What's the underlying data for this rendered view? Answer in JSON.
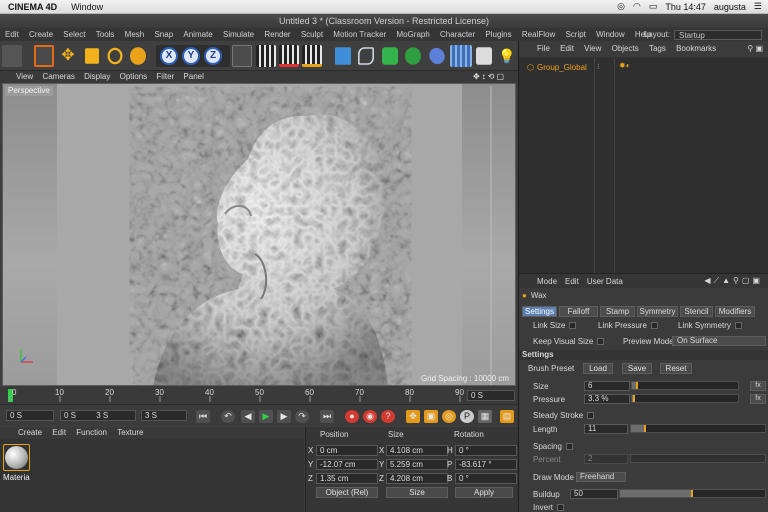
{
  "macbar": {
    "app": "CINEMA 4D",
    "menu": "Window",
    "clock": "Thu 14:47",
    "user": "augusta"
  },
  "window": {
    "title": "Untitled 3 * (Classroom Version - Restricted License)"
  },
  "menubar": {
    "items": [
      "Edit",
      "Create",
      "Select",
      "Tools",
      "Mesh",
      "Snap",
      "Animate",
      "Simulate",
      "Render",
      "Sculpt",
      "Motion Tracker",
      "MoGraph",
      "Character",
      "Plugins",
      "RealFlow",
      "Script",
      "Window",
      "Help"
    ],
    "layout_label": "Layout:",
    "layout_value": "Startup"
  },
  "viewport": {
    "menu": [
      "View",
      "Cameras",
      "Display",
      "Options",
      "Filter",
      "Panel"
    ],
    "label": "Perspective",
    "grid_spacing": "Grid Spacing : 10000 cm"
  },
  "timeline": {
    "ticks": [
      "0",
      "10",
      "20",
      "30",
      "40",
      "50",
      "60",
      "70",
      "80",
      "90"
    ],
    "end_frame": "0 S"
  },
  "transport": {
    "current": "0 S",
    "range_start": "0 S",
    "range_end": "3 S",
    "max": "3 S"
  },
  "material": {
    "menu": [
      "Create",
      "Edit",
      "Function",
      "Texture"
    ],
    "items": [
      {
        "name": "Materia"
      }
    ]
  },
  "coordinates": {
    "headers": {
      "position": "Position",
      "size": "Size",
      "rotation": "Rotation"
    },
    "rows": [
      {
        "axis": "X",
        "pos": "0 cm",
        "size_axis": "X",
        "size": "4.108 cm",
        "rot_axis": "H",
        "rot": "0 °"
      },
      {
        "axis": "Y",
        "pos": "-12.07 cm",
        "size_axis": "Y",
        "size": "5.259 cm",
        "rot_axis": "P",
        "rot": "-83.617 °"
      },
      {
        "axis": "Z",
        "pos": "1.35 cm",
        "size_axis": "Z",
        "size": "4.208 cm",
        "rot_axis": "B",
        "rot": "0 °"
      }
    ],
    "mode": "Object (Rel)",
    "size_mode": "Size",
    "apply": "Apply"
  },
  "objects": {
    "menu": [
      "File",
      "Edit",
      "View",
      "Objects",
      "Tags",
      "Bookmarks"
    ],
    "items": [
      {
        "name": "Group_Global"
      }
    ]
  },
  "attributes": {
    "menu": [
      "Mode",
      "Edit",
      "User Data"
    ],
    "tool_name": "Wax",
    "tabs": [
      "Settings",
      "Falloff",
      "Stamp",
      "Symmetry",
      "Stencil",
      "Modifiers"
    ],
    "link_size": "Link Size",
    "link_pressure": "Link Pressure",
    "link_symmetry": "Link Symmetry",
    "keep_visual_size": "Keep Visual Size",
    "preview_mode_label": "Preview Mode",
    "preview_mode_value": "On Surface",
    "section": "Settings",
    "brush_preset": "Brush Preset",
    "load": "Load",
    "save": "Save",
    "reset": "Reset",
    "size_label": "Size",
    "size_value": "6",
    "size_fraction": 0.06,
    "pressure_label": "Pressure",
    "pressure_value": "3.3 %",
    "pressure_fraction": 0.033,
    "fx": "fx",
    "steady_stroke": "Steady Stroke",
    "length_label": "Length",
    "length_value": "11",
    "length_fraction": 0.11,
    "spacing": "Spacing",
    "percent_label": "Percent",
    "percent_value": "2",
    "draw_mode_label": "Draw Mode",
    "draw_mode_value": "Freehand",
    "buildup_label": "Buildup",
    "buildup_value": "50",
    "buildup_fraction": 0.5,
    "invert": "Invert"
  }
}
